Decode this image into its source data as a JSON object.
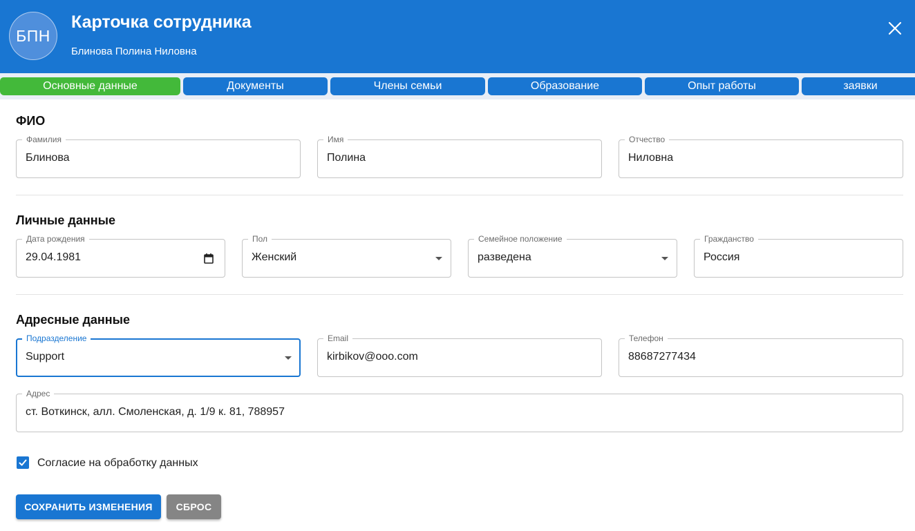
{
  "colors": {
    "primary": "#1976d2",
    "active_tab": "#43b93a",
    "reset_button": "#858585"
  },
  "header": {
    "avatar_initials": "БПН",
    "title": "Карточка сотрудника",
    "subtitle": "Блинова Полина Ниловна",
    "close_icon": "close-icon"
  },
  "tabs": [
    {
      "label": "Основные данные",
      "active": true
    },
    {
      "label": "Документы",
      "active": false
    },
    {
      "label": "Члены семьи",
      "active": false
    },
    {
      "label": "Образование",
      "active": false
    },
    {
      "label": "Опыт работы",
      "active": false
    },
    {
      "label": "заявки",
      "active": false
    }
  ],
  "sections": {
    "fio": {
      "title": "ФИО",
      "last_name": {
        "label": "Фамилия",
        "value": "Блинова"
      },
      "first_name": {
        "label": "Имя",
        "value": "Полина"
      },
      "patronymic": {
        "label": "Отчество",
        "value": "Ниловна"
      }
    },
    "personal": {
      "title": "Личные данные",
      "birth_date": {
        "label": "Дата рождения",
        "value": "29.04.1981",
        "icon": "calendar-icon"
      },
      "gender": {
        "label": "Пол",
        "value": "Женский"
      },
      "marital_status": {
        "label": "Семейное положение",
        "value": "разведена"
      },
      "citizenship": {
        "label": "Гражданство",
        "value": "Россия"
      }
    },
    "address": {
      "title": "Адресные данные",
      "department": {
        "label": "Подразделение",
        "value": "Support"
      },
      "email": {
        "label": "Email",
        "value": "kirbikov@ooo.com"
      },
      "phone": {
        "label": "Телефон",
        "value": "88687277434"
      },
      "address": {
        "label": "Адрес",
        "value": "ст. Воткинск, алл. Смоленская, д. 1/9 к. 81, 788957"
      }
    }
  },
  "consent": {
    "label": "Согласие на обработку данных",
    "checked": true
  },
  "actions": {
    "save_label": "СОХРАНИТЬ ИЗМЕНЕНИЯ",
    "reset_label": "СБРОС"
  }
}
